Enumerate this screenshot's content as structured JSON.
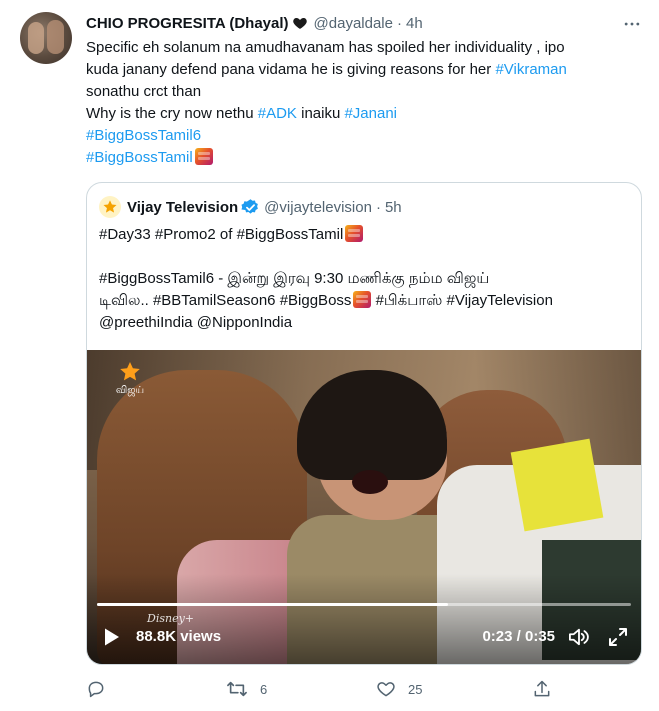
{
  "tweet": {
    "author": {
      "name": "CHIO PROGRESITA (Dhayal)",
      "name_emoji": "black-heart",
      "handle": "@dayaldale",
      "separator": "·",
      "time": "4h"
    },
    "text": {
      "line1": "Specific eh solanum na amudhavanam has spoiled her individuality , ipo",
      "line2_plain": "kuda janany defend pana vidama he is giving reasons for her ",
      "line2_tag": "#Vikraman",
      "line3": "sonathu crct than",
      "line4_plain": "Why is the cry now nethu ",
      "line4_tag1": "#ADK",
      "line4_mid": " inaiku ",
      "line4_tag2": "#Janani",
      "line5_tag": "#BiggBossTamil6",
      "line6_tag": "#BiggBossTamil"
    },
    "quoted": {
      "author": {
        "name": "Vijay Television",
        "handle": "@vijaytelevision",
        "separator": "·",
        "time": "5h"
      },
      "text": {
        "line1": "#Day33 #Promo2 of #BiggBossTamil",
        "line2": "#BiggBossTamil6 - இன்று இரவு 9:30 மணிக்கு நம்ம விஜய்",
        "line3_a": "டிவில.. #BBTamilSeason6 #BiggBoss",
        "line3_b": " #பிக்பாஸ் #VijayTelevision",
        "line4": "@preethiIndia  @NipponIndia"
      },
      "video": {
        "channel_logo_text": "விஜய்",
        "watermark": "Disney+",
        "views": "88.8K views",
        "time_display": "0:23 / 0:35",
        "progress": 0.657
      }
    },
    "actions": {
      "reply_count": "",
      "retweet_count": "6",
      "like_count": "25"
    }
  },
  "colors": {
    "link": "#1d9bf0",
    "text": "#0f1419",
    "secondary": "#536471",
    "border": "#cfd9de",
    "verified": "#1d9bf0"
  }
}
